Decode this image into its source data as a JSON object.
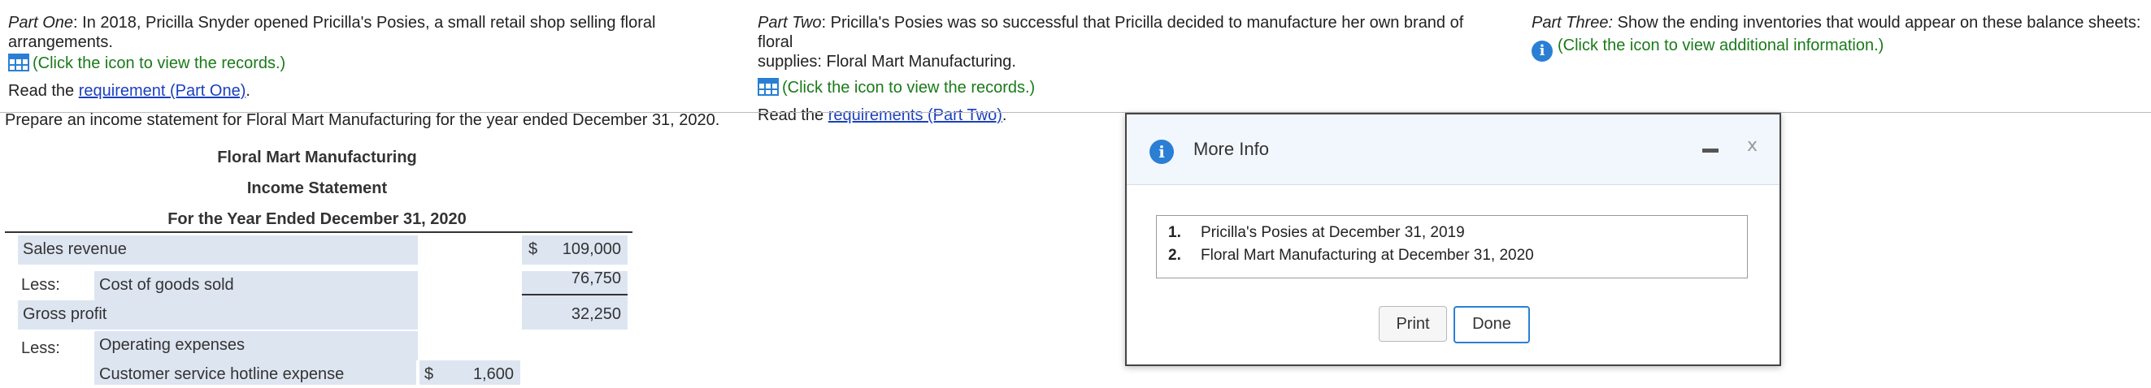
{
  "part_one": {
    "prefix": "Part One",
    "text": ": In 2018, Pricilla Snyder opened Pricilla's Posies, a small retail shop selling floral arrangements.",
    "records_link": "(Click the icon to view the records.)",
    "read_prefix": "Read the ",
    "requirement_link": "requirement (Part One)",
    "read_suffix": "."
  },
  "part_two": {
    "prefix": "Part Two",
    "text_line1": ": Pricilla's Posies was so successful that Pricilla decided to manufacture her own brand of floral",
    "text_line2": "supplies: Floral Mart Manufacturing.",
    "records_link": "(Click the icon to view the records.)",
    "read_prefix": "Read the ",
    "requirement_link": "requirements (Part Two)",
    "read_suffix": "."
  },
  "part_three": {
    "prefix": "Part Three:",
    "text": " Show the ending inventories that would appear on these balance sheets:",
    "info_link": "(Click the icon to view additional information.)"
  },
  "instruction": "Prepare an income statement for Floral Mart Manufacturing for the year ended December 31, 2020.",
  "statement": {
    "company": "Floral Mart Manufacturing",
    "title": "Income Statement",
    "period": "For the Year Ended December 31, 2020",
    "rows": {
      "sales_label": "Sales revenue",
      "sales_currency": "$",
      "sales_value": "109,000",
      "less1": "Less:",
      "cogs_label": "Cost of goods sold",
      "cogs_value": "76,750",
      "gross_label": "Gross profit",
      "gross_value": "32,250",
      "less2": "Less:",
      "opex_label": "Operating expenses",
      "hotline_label": "Customer service hotline expense",
      "hotline_currency": "$",
      "hotline_value": "1,600"
    }
  },
  "modal": {
    "title": "More Info",
    "close_glyph": "x",
    "items": [
      {
        "num": "1.",
        "text": "Pricilla's Posies at December 31, 2019"
      },
      {
        "num": "2.",
        "text": "Floral Mart Manufacturing at December 31, 2020"
      }
    ],
    "print_label": "Print",
    "done_label": "Done"
  },
  "colors": {
    "accent": "#2a7fd4",
    "link_green": "#1a7a1a",
    "row_shade": "#dde5f1"
  }
}
